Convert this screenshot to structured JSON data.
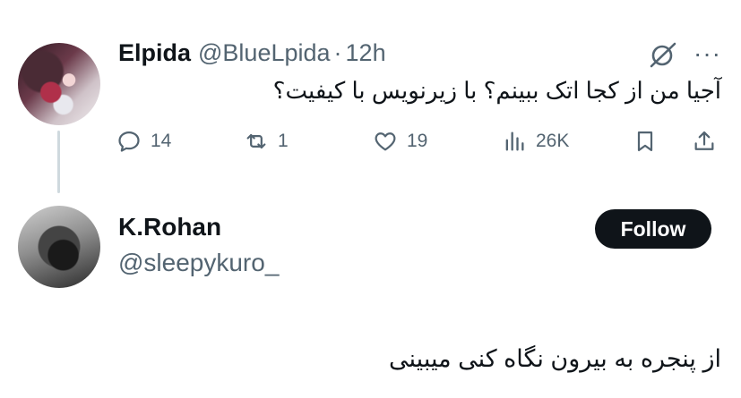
{
  "parent_tweet": {
    "display_name": "Elpida",
    "handle": "@BlueLpida",
    "separator": "·",
    "time": "12h",
    "text": "آجیا من از کجا اتک ببینم؟ با زیرنویس با کیفیت؟",
    "more_label": "···",
    "actions": {
      "replies": "14",
      "reposts": "1",
      "likes": "19",
      "views": "26K"
    }
  },
  "reply_tweet": {
    "display_name": "K.Rohan",
    "handle": "@sleepykuro_",
    "follow_label": "Follow",
    "text": "از پنجره به بیرون نگاه کنی میبینی"
  },
  "icons": [
    "reply-icon",
    "repost-icon",
    "like-icon",
    "views-icon",
    "bookmark-icon",
    "share-icon",
    "grok-icon",
    "more-icon"
  ],
  "colors": {
    "text": "#0f1419",
    "muted": "#536471",
    "follow_bg": "#0f1419",
    "thread_line": "#cfd9de"
  }
}
